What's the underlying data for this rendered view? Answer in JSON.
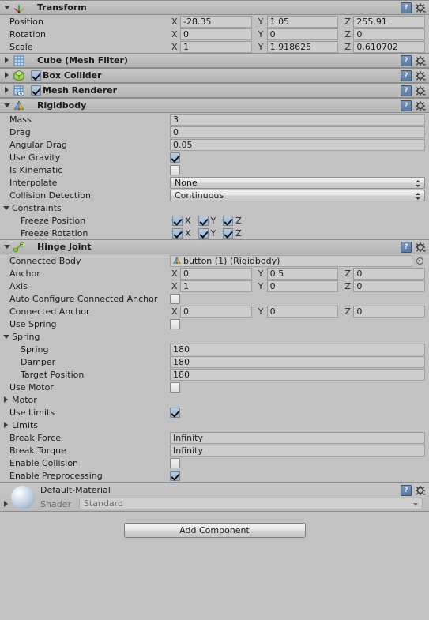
{
  "components": [
    {
      "id": "transform",
      "title": "Transform",
      "expanded": true,
      "has_enable_checkbox": false,
      "icon": "transform-axis-icon",
      "rows": [
        {
          "label": "Position",
          "type": "vector3",
          "axes": [
            "X",
            "Y",
            "Z"
          ],
          "values": [
            "-28.35",
            "1.05",
            "255.91"
          ]
        },
        {
          "label": "Rotation",
          "type": "vector3",
          "axes": [
            "X",
            "Y",
            "Z"
          ],
          "values": [
            "0",
            "0",
            "0"
          ]
        },
        {
          "label": "Scale",
          "type": "vector3",
          "axes": [
            "X",
            "Y",
            "Z"
          ],
          "values": [
            "1",
            "1.918625",
            "0.610702"
          ]
        }
      ]
    },
    {
      "id": "mesh-filter",
      "title": "Cube (Mesh Filter)",
      "expanded": false,
      "has_enable_checkbox": false,
      "icon": "mesh-filter-icon",
      "rows": []
    },
    {
      "id": "box-collider",
      "title": "Box Collider",
      "expanded": false,
      "has_enable_checkbox": true,
      "enabled": true,
      "icon": "box-collider-icon",
      "rows": []
    },
    {
      "id": "mesh-renderer",
      "title": "Mesh Renderer",
      "expanded": false,
      "has_enable_checkbox": true,
      "enabled": true,
      "icon": "mesh-renderer-icon",
      "rows": []
    },
    {
      "id": "rigidbody",
      "title": "Rigidbody",
      "expanded": true,
      "has_enable_checkbox": false,
      "icon": "rigidbody-icon",
      "rows": [
        {
          "label": "Mass",
          "type": "text",
          "value": "3"
        },
        {
          "label": "Drag",
          "type": "text",
          "value": "0"
        },
        {
          "label": "Angular Drag",
          "type": "text",
          "value": "0.05"
        },
        {
          "label": "Use Gravity",
          "type": "checkbox",
          "checked": true
        },
        {
          "label": "Is Kinematic",
          "type": "checkbox",
          "checked": false
        },
        {
          "label": "Interpolate",
          "type": "popup",
          "value": "None"
        },
        {
          "label": "Collision Detection",
          "type": "popup",
          "value": "Continuous"
        },
        {
          "label": "Constraints",
          "type": "foldout",
          "expanded": true
        },
        {
          "label": "Freeze Position",
          "type": "axis-checks",
          "indent": 1,
          "axes": [
            "X",
            "Y",
            "Z"
          ],
          "checked": [
            true,
            true,
            true
          ]
        },
        {
          "label": "Freeze Rotation",
          "type": "axis-checks",
          "indent": 1,
          "axes": [
            "X",
            "Y",
            "Z"
          ],
          "checked": [
            true,
            true,
            true
          ]
        }
      ]
    },
    {
      "id": "hinge-joint",
      "title": "Hinge Joint",
      "expanded": true,
      "has_enable_checkbox": false,
      "icon": "hinge-joint-icon",
      "rows": [
        {
          "label": "Connected Body",
          "type": "object",
          "value": "button (1) (Rigidbody)",
          "object_icon": "rigidbody-icon"
        },
        {
          "label": "Anchor",
          "type": "vector3",
          "axes": [
            "X",
            "Y",
            "Z"
          ],
          "values": [
            "0",
            "0.5",
            "0"
          ]
        },
        {
          "label": "Axis",
          "type": "vector3",
          "axes": [
            "X",
            "Y",
            "Z"
          ],
          "values": [
            "1",
            "0",
            "0"
          ]
        },
        {
          "label": "Auto Configure Connected Anchor",
          "type": "checkbox",
          "checked": false
        },
        {
          "label": "Connected Anchor",
          "type": "vector3",
          "axes": [
            "X",
            "Y",
            "Z"
          ],
          "values": [
            "0",
            "0",
            "0"
          ]
        },
        {
          "label": "Use Spring",
          "type": "checkbox",
          "checked": false
        },
        {
          "label": "Spring",
          "type": "foldout",
          "expanded": true
        },
        {
          "label": "Spring",
          "type": "text",
          "value": "180",
          "indent": 1
        },
        {
          "label": "Damper",
          "type": "text",
          "value": "180",
          "indent": 1
        },
        {
          "label": "Target Position",
          "type": "text",
          "value": "180",
          "indent": 1
        },
        {
          "label": "Use Motor",
          "type": "checkbox",
          "checked": false
        },
        {
          "label": "Motor",
          "type": "foldout",
          "expanded": false
        },
        {
          "label": "Use Limits",
          "type": "checkbox",
          "checked": true
        },
        {
          "label": "Limits",
          "type": "foldout",
          "expanded": false
        },
        {
          "label": "Break Force",
          "type": "text",
          "value": "Infinity"
        },
        {
          "label": "Break Torque",
          "type": "text",
          "value": "Infinity"
        },
        {
          "label": "Enable Collision",
          "type": "checkbox",
          "checked": false
        },
        {
          "label": "Enable Preprocessing",
          "type": "checkbox",
          "checked": true
        }
      ]
    }
  ],
  "material": {
    "name": "Default-Material",
    "shader_label": "Shader",
    "shader_value": "Standard"
  },
  "footer": {
    "add_component_label": "Add Component"
  },
  "colors": {
    "background": "#c2c2c2",
    "header_gradient_top": "#c9c9c9",
    "header_gradient_bottom": "#b4b4b4",
    "field_background": "#cdcdcd",
    "field_border": "#a0a0a0",
    "separator": "#8c8c8c",
    "checkbox_on": "#9ab4d2",
    "text": "#1c1c1c",
    "text_muted": "#6e6e6e"
  }
}
